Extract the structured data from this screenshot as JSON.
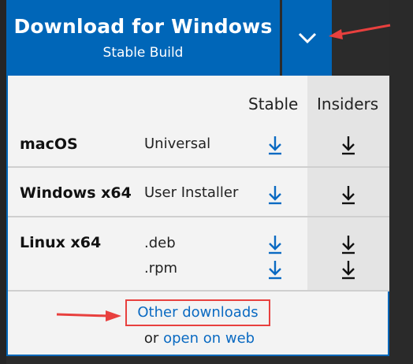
{
  "download_button": {
    "title": "Download for Windows",
    "subtitle": "Stable Build"
  },
  "dropdown_toggle": {
    "icon": "chevron-down-icon"
  },
  "table": {
    "headers": {
      "stable": "Stable",
      "insiders": "Insiders"
    },
    "rows": [
      {
        "os": "macOS",
        "variants": [
          "Universal"
        ]
      },
      {
        "os": "Windows x64",
        "variants": [
          "User Installer"
        ]
      },
      {
        "os": "Linux x64",
        "variants": [
          ".deb",
          ".rpm"
        ]
      }
    ]
  },
  "footer": {
    "other_downloads": "Other downloads",
    "or_text": "or",
    "open_on_web": "open on web"
  },
  "colors": {
    "accent": "#0066b8",
    "link": "#0a6ac2",
    "annotation_red": "#e8403e",
    "insiders_shade": "#e4e4e4"
  }
}
